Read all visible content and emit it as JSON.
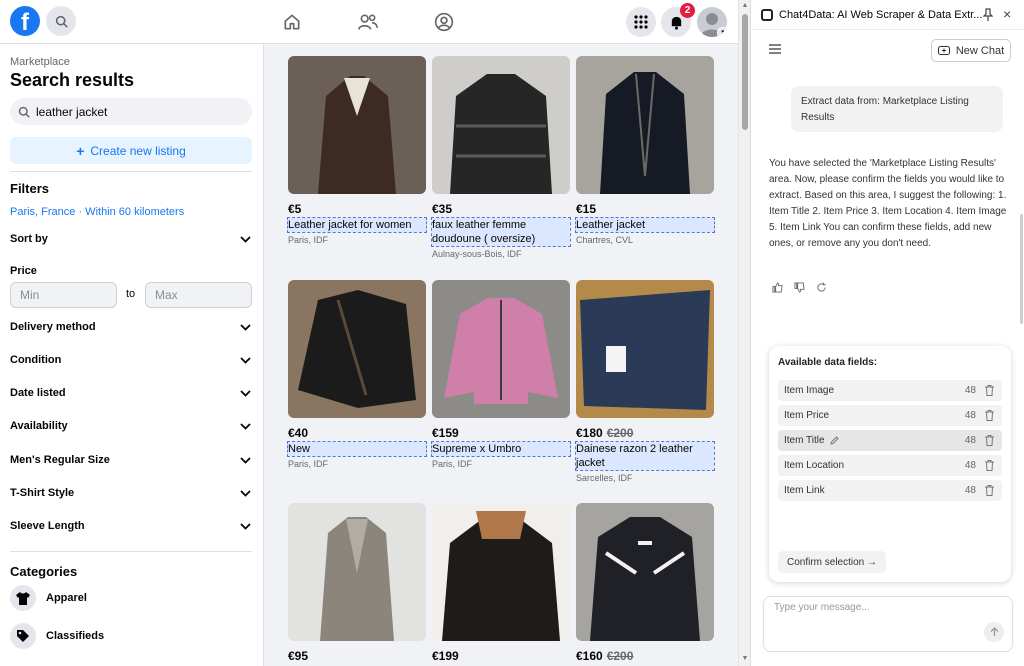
{
  "topbar": {
    "logo_letter": "f",
    "notif_count": "2"
  },
  "sidebar": {
    "breadcrumb": "Marketplace",
    "title": "Search results",
    "search_value": "leather jacket",
    "create_label": "Create new listing",
    "filters_heading": "Filters",
    "location": "Paris, France · Within 60 kilometers",
    "sort_by": "Sort by",
    "price_label": "Price",
    "min_placeholder": "Min",
    "to_label": "to",
    "max_placeholder": "Max",
    "filters": [
      "Delivery method",
      "Condition",
      "Date listed",
      "Availability",
      "Men's Regular Size",
      "T-Shirt Style",
      "Sleeve Length"
    ],
    "categories_heading": "Categories",
    "categories": [
      "Apparel",
      "Classifieds"
    ]
  },
  "listings": [
    {
      "price": "€5",
      "old_price": "",
      "title": "Leather jacket for women",
      "location": "Paris, IDF",
      "colors": [
        "#6b6058",
        "#3d2a22",
        "#e9e3d7"
      ]
    },
    {
      "price": "€35",
      "old_price": "",
      "title": "faux leather femme doudoune ( oversize)",
      "location": "Aulnay-sous-Bois, IDF",
      "colors": [
        "#cfcdca",
        "#262626",
        "#5a5a5a"
      ]
    },
    {
      "price": "€15",
      "old_price": "",
      "title": "Leather jacket",
      "location": "Chartres, CVL",
      "colors": [
        "#a7a49e",
        "#161a24",
        "#6d6a66"
      ]
    },
    {
      "price": "€40",
      "old_price": "",
      "title": "New",
      "location": "Paris, IDF",
      "colors": [
        "#8a7560",
        "#1c1b1b",
        "#5c4a38"
      ]
    },
    {
      "price": "€159",
      "old_price": "",
      "title": "Supreme x Umbro",
      "location": "Paris, IDF",
      "colors": [
        "#8d8b88",
        "#cf7fa8",
        "#3b3b3b"
      ]
    },
    {
      "price": "€180",
      "old_price": "€200",
      "title": "Dainese razon 2 leather jacket",
      "location": "Sarcelles, IDF",
      "colors": [
        "#b48a4a",
        "#2b3a56",
        "#f4f4f4"
      ]
    },
    {
      "price": "€95",
      "old_price": "",
      "title": "",
      "location": "",
      "colors": [
        "#e2e2e0",
        "#8c857c",
        "#b3aca2"
      ]
    },
    {
      "price": "€199",
      "old_price": "",
      "title": "",
      "location": "",
      "colors": [
        "#f0efec",
        "#1f1b19",
        "#b0784a"
      ]
    },
    {
      "price": "€160",
      "old_price": "€200",
      "title": "",
      "location": "",
      "colors": [
        "#a6a4a0",
        "#202126",
        "#f2f2f2"
      ]
    }
  ],
  "selected_titles": [
    0,
    1,
    2,
    3,
    4,
    5
  ],
  "panel": {
    "title": "Chat4Data: AI Web Scraper & Data Extr...",
    "new_chat": "New Chat",
    "user_message": "Extract data from: Marketplace Listing Results",
    "bot_message": "You have selected the 'Marketplace Listing Results' area. Now, please confirm the fields you would like to extract. Based on this area, I suggest the following: 1. Item Title 2. Item Price 3. Item Location 4. Item Image 5. Item Link You can confirm these fields, add new ones, or remove any you don't need.",
    "fields_heading": "Available data fields:",
    "fields": [
      {
        "name": "Item Image",
        "count": "48"
      },
      {
        "name": "Item Price",
        "count": "48"
      },
      {
        "name": "Item Title",
        "count": "48"
      },
      {
        "name": "Item Location",
        "count": "48"
      },
      {
        "name": "Item Link",
        "count": "48"
      }
    ],
    "confirm_label": "Confirm selection →",
    "composer_placeholder": "Type your message..."
  }
}
